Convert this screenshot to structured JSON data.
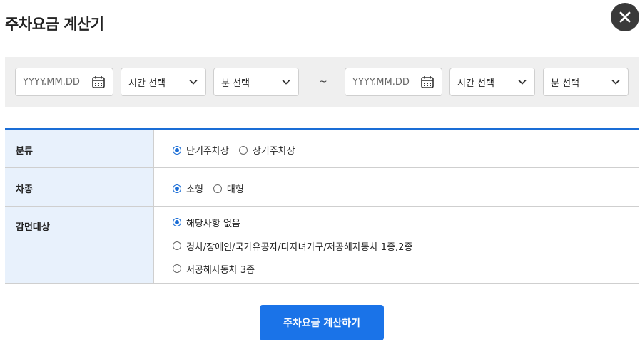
{
  "header": {
    "title": "주차요금 계산기"
  },
  "period": {
    "start": {
      "date_placeholder": "YYYY.MM.DD",
      "hour_label": "시간 선택",
      "minute_label": "분 선택"
    },
    "separator": "~",
    "end": {
      "date_placeholder": "YYYY.MM.DD",
      "hour_label": "시간 선택",
      "minute_label": "분 선택"
    }
  },
  "form": {
    "category": {
      "label": "분류",
      "options": [
        {
          "label": "단기주차장",
          "selected": true
        },
        {
          "label": "장기주차장",
          "selected": false
        }
      ]
    },
    "vehicle": {
      "label": "차종",
      "options": [
        {
          "label": "소형",
          "selected": true
        },
        {
          "label": "대형",
          "selected": false
        }
      ]
    },
    "discount": {
      "label": "감면대상",
      "options": [
        {
          "label": "해당사항 없음",
          "selected": true
        },
        {
          "label": "경차/장애인/국가유공자/다자녀가구/저공해자동차 1종,2종",
          "selected": false
        },
        {
          "label": "저공해자동차 3종",
          "selected": false
        }
      ]
    }
  },
  "submit_label": "주차요금 계산하기",
  "colors": {
    "accent": "#1a73e8",
    "header_bg": "#e8f1fc",
    "bar_bg": "#efefef"
  }
}
